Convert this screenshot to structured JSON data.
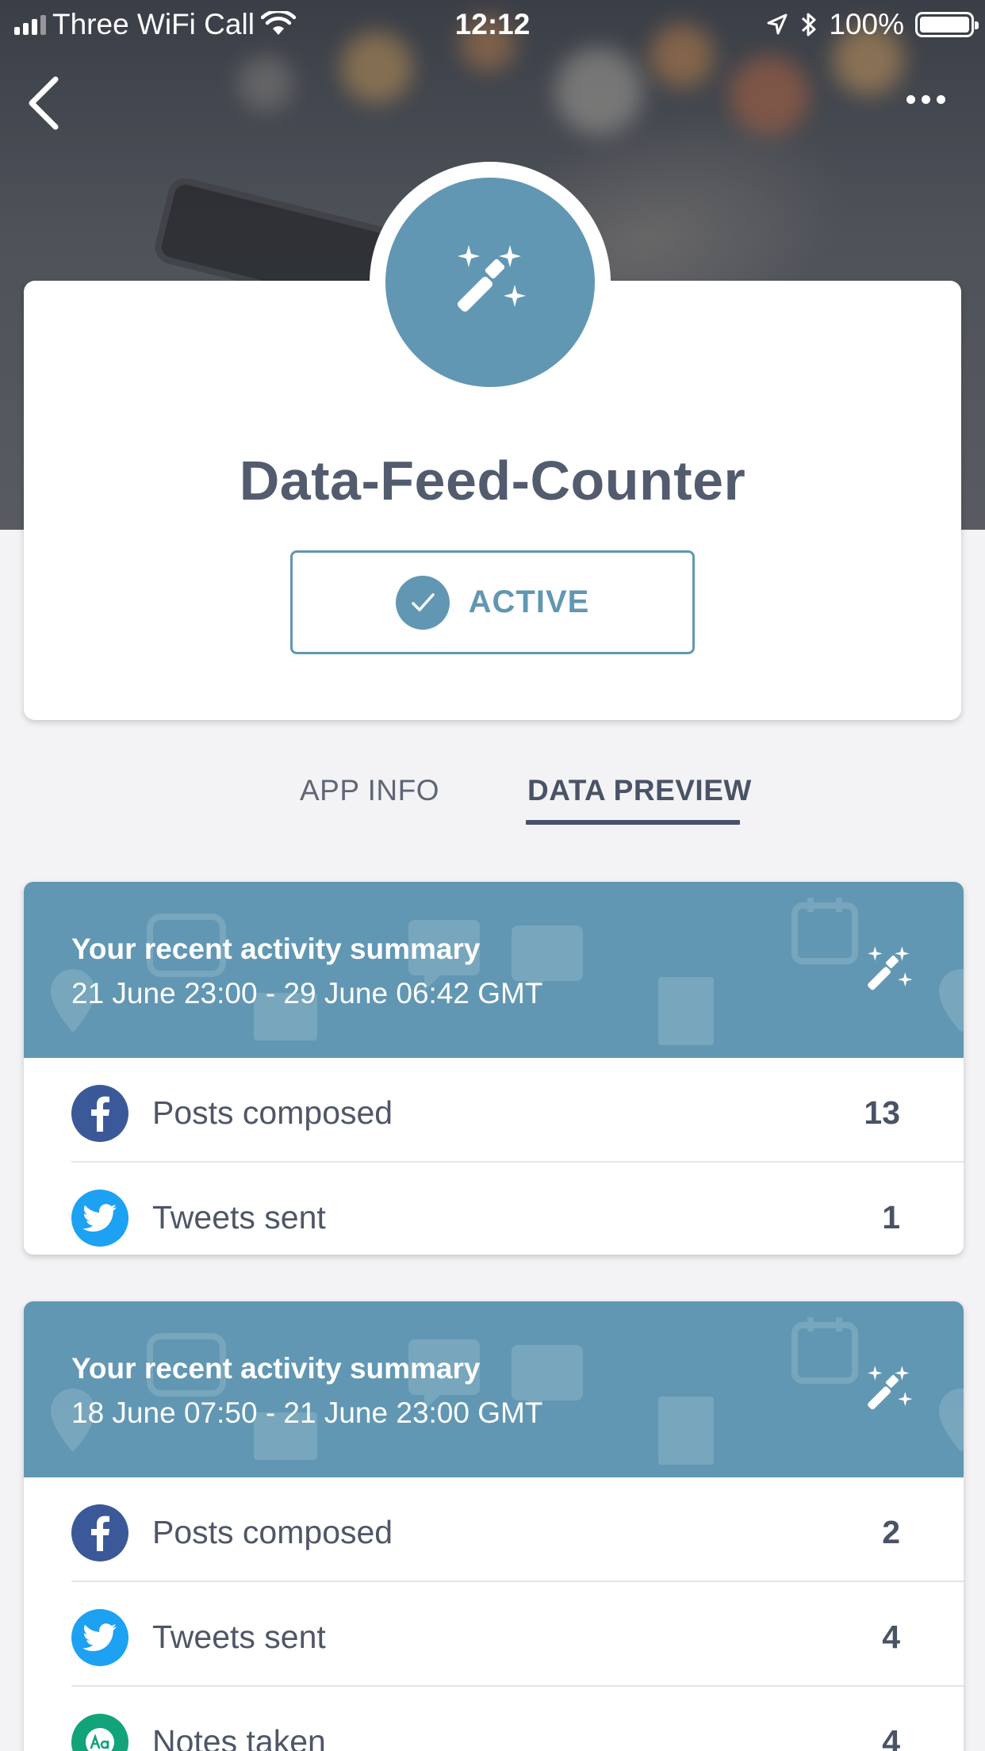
{
  "status_bar": {
    "carrier": "Three WiFi Call",
    "time": "12:12",
    "battery": "100%"
  },
  "app": {
    "name": "Data-Feed-Counter",
    "status_label": "ACTIVE",
    "accent_color": "#6197b3"
  },
  "tabs": [
    {
      "label": "APP INFO",
      "selected": false
    },
    {
      "label": "DATA PREVIEW",
      "selected": true
    }
  ],
  "summaries": [
    {
      "title": "Your recent activity summary",
      "range": "21 June 23:00 - 29 June 06:42 GMT",
      "rows": [
        {
          "icon": "facebook-icon",
          "label": "Posts composed",
          "value": "13"
        },
        {
          "icon": "twitter-icon",
          "label": "Tweets sent",
          "value": "1"
        }
      ]
    },
    {
      "title": "Your recent activity summary",
      "range": "18 June 07:50 - 21 June 23:00 GMT",
      "rows": [
        {
          "icon": "facebook-icon",
          "label": "Posts composed",
          "value": "2"
        },
        {
          "icon": "twitter-icon",
          "label": "Tweets sent",
          "value": "4"
        },
        {
          "icon": "notes-icon",
          "label": "Notes taken",
          "value": "4"
        }
      ]
    }
  ]
}
